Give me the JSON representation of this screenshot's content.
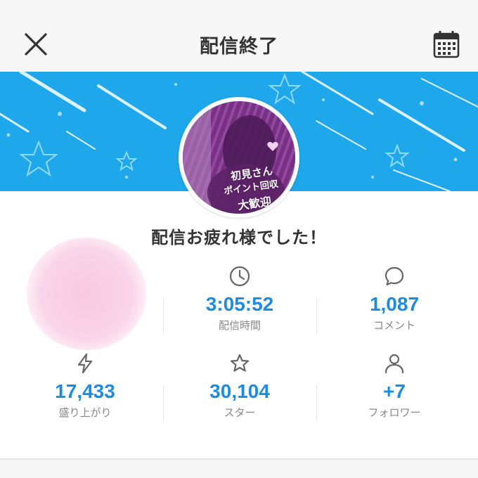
{
  "header": {
    "title": "配信終了",
    "close_icon": "close-icon",
    "calendar_icon": "calendar-icon"
  },
  "banner": {
    "color": "#1ea7ea",
    "thumbnail_text": {
      "line1": "初見さん",
      "line2": "ポイント回収",
      "line3": "大歓迎"
    }
  },
  "message": "配信お疲れ様でした！",
  "stats": [
    {
      "icon": "clock-icon",
      "value": "3:05:52",
      "label": "配信時間"
    },
    {
      "icon": "comment-icon",
      "value": "1,087",
      "label": "コメント"
    },
    {
      "icon": "lightning-icon",
      "value": "17,433",
      "label": "盛り上がり"
    },
    {
      "icon": "star-icon",
      "value": "30,104",
      "label": "スター"
    },
    {
      "icon": "person-icon",
      "value": "+7",
      "label": "フォロワー"
    }
  ],
  "colors": {
    "accent": "#1a8de0",
    "banner": "#1ea7ea",
    "blur": "#f8c9e2"
  }
}
